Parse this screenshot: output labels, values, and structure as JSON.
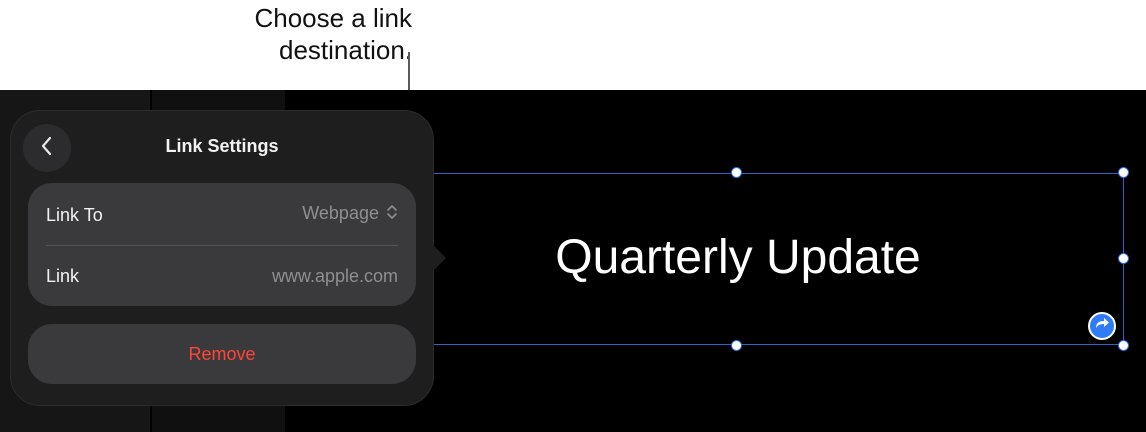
{
  "callout": {
    "text_line1": "Choose a link",
    "text_line2": "destination."
  },
  "slide": {
    "title": "Quarterly Update"
  },
  "popover": {
    "title": "Link Settings",
    "link_to_label": "Link To",
    "link_to_value": "Webpage",
    "link_label": "Link",
    "link_placeholder": "www.apple.com",
    "remove_label": "Remove"
  },
  "colors": {
    "accent": "#2f7cf6",
    "destructive": "#ff453a",
    "canvas": "#000000",
    "popover_bg": "#1e1e1e",
    "group_bg": "#3a3a3c"
  },
  "icons": {
    "back": "chevron-left-icon",
    "stepper": "chevron-up-down-icon",
    "link_badge": "curved-arrow-icon"
  }
}
